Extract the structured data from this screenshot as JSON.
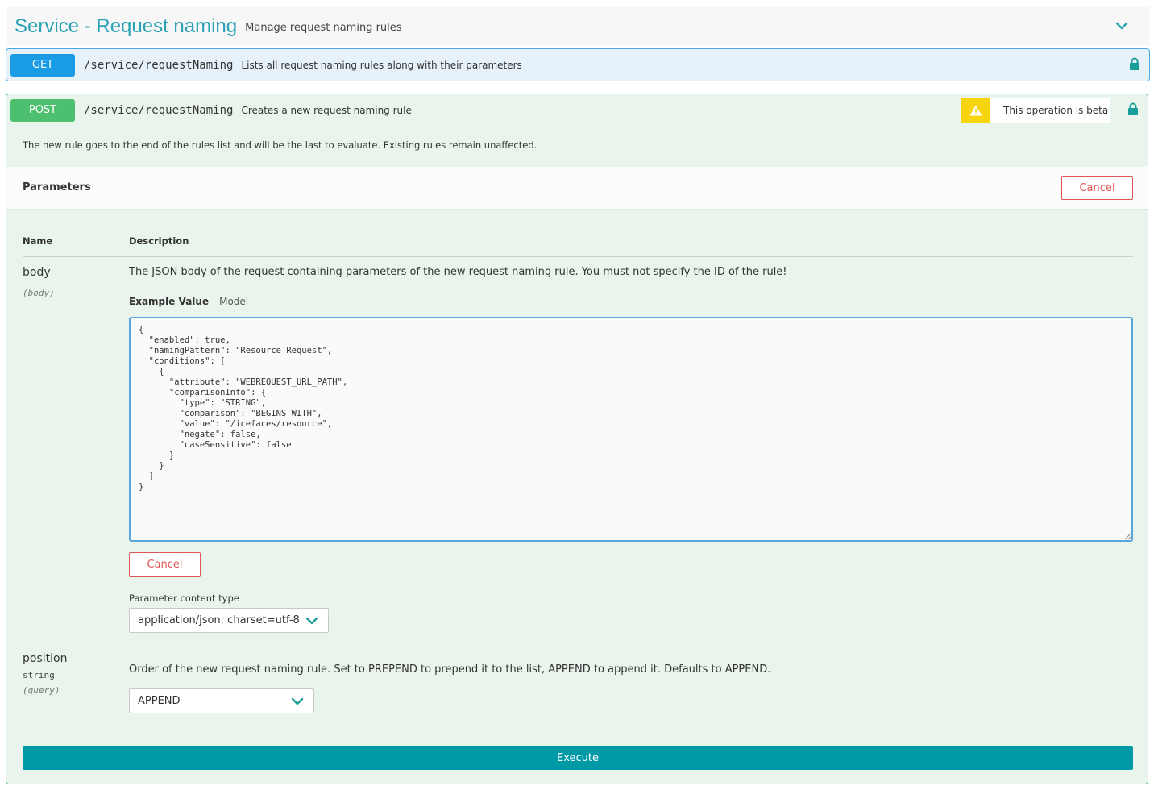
{
  "section": {
    "title": "Service - Request naming",
    "subtitle": "Manage request naming rules"
  },
  "get_op": {
    "method": "GET",
    "path": "/service/requestNaming",
    "description": "Lists all request naming rules along with their parameters"
  },
  "post_op": {
    "method": "POST",
    "path": "/service/requestNaming",
    "description": "Creates a new request naming rule",
    "beta_label": "This operation is beta",
    "long_description": "The new rule goes to the end of the rules list and will be the last to evaluate. Existing rules remain unaffected."
  },
  "parameters": {
    "title": "Parameters",
    "cancel_label": "Cancel",
    "name_header": "Name",
    "description_header": "Description"
  },
  "body_param": {
    "name": "body",
    "in": "(body)",
    "description": "The JSON body of the request containing parameters of the new request naming rule. You must not specify the ID of the rule!",
    "tab_example": "Example Value",
    "tab_model": "Model",
    "editor_value": "{\n  \"enabled\": true,\n  \"namingPattern\": \"Resource Request\",\n  \"conditions\": [\n    {\n      \"attribute\": \"WEBREQUEST_URL_PATH\",\n      \"comparisonInfo\": {\n        \"type\": \"STRING\",\n        \"comparison\": \"BEGINS_WITH\",\n        \"value\": \"/icefaces/resource\",\n        \"negate\": false,\n        \"caseSensitive\": false\n      }\n    }\n  ]\n}",
    "cancel_label": "Cancel",
    "content_type_label": "Parameter content type",
    "content_type_value": "application/json; charset=utf-8"
  },
  "position_param": {
    "name": "position",
    "type": "string",
    "in": "(query)",
    "description": "Order of the new request naming rule. Set to PREPEND to prepend it to the list, APPEND to append it. Defaults to APPEND.",
    "selected": "APPEND"
  },
  "execute_label": "Execute",
  "colors": {
    "accent": "#2aa2b3",
    "get": "#1a9be6",
    "post": "#4cc06f",
    "beta": "#f6d40e",
    "cancel": "#e05555",
    "execute": "#009aa6"
  }
}
